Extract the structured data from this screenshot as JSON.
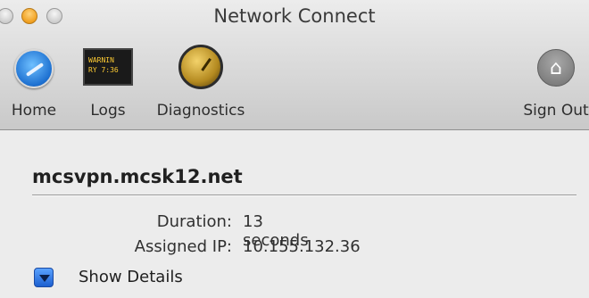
{
  "window": {
    "title": "Network Connect"
  },
  "toolbar": {
    "home_label": "Home",
    "logs_label": "Logs",
    "logs_icon_text": [
      "WARNIN",
      "RY 7:36"
    ],
    "diagnostics_label": "Diagnostics",
    "signout_label": "Sign Out",
    "signout_icon_glyph": "⌂"
  },
  "connection": {
    "host": "mcsvpn.mcsk12.net",
    "duration_label": "Duration:",
    "duration_value": "13 seconds",
    "ip_label": "Assigned IP:",
    "ip_value": "10.155.132.36",
    "show_details_label": "Show Details"
  }
}
